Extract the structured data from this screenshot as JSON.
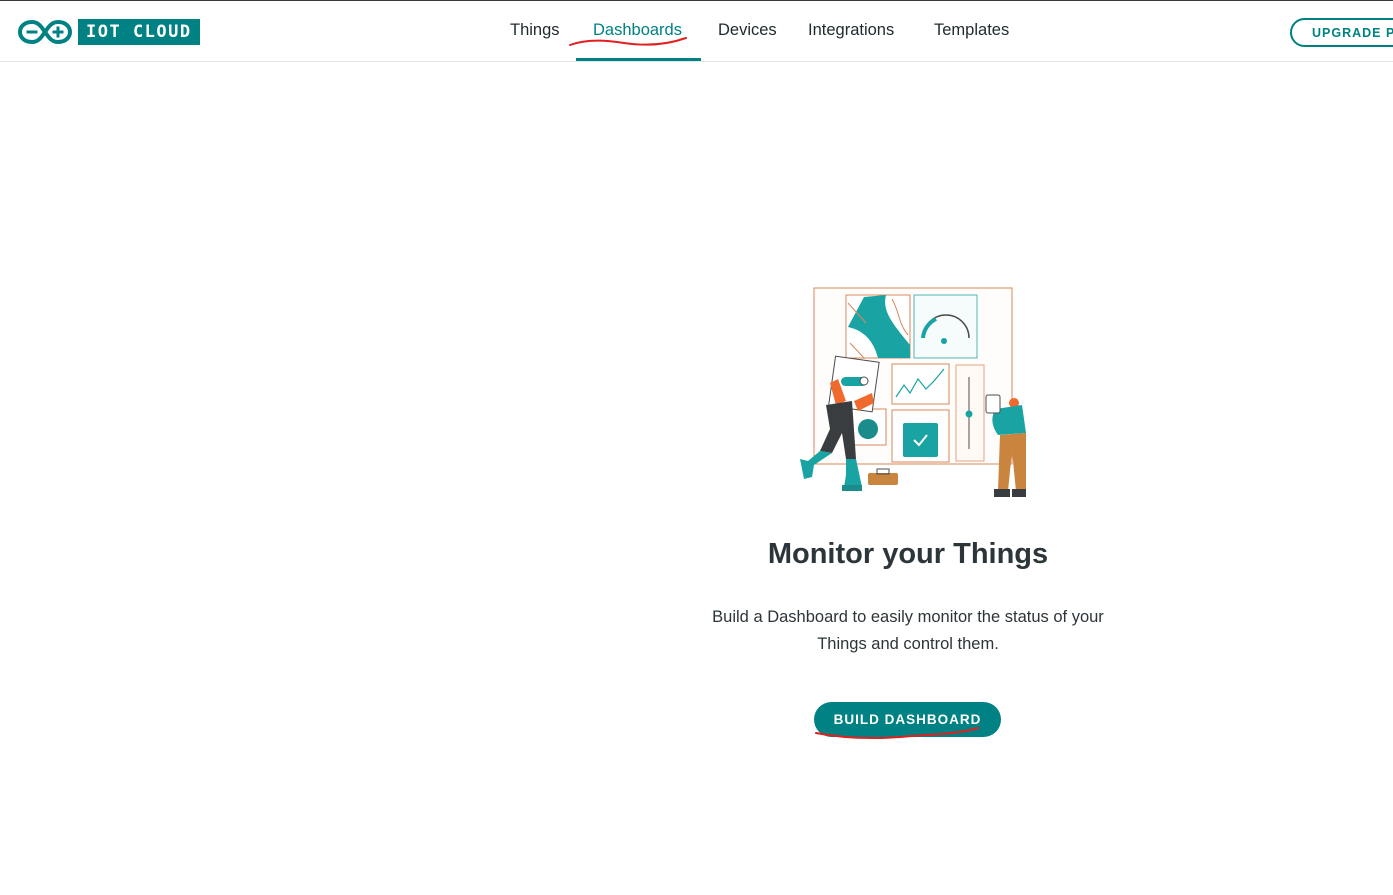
{
  "brand": {
    "logo_text": "IOT CLOUD",
    "icon": "infinity-plus-minus-icon",
    "accent_color": "#008184"
  },
  "nav": {
    "items": [
      {
        "label": "Things",
        "active": false
      },
      {
        "label": "Dashboards",
        "active": true
      },
      {
        "label": "Devices",
        "active": false
      },
      {
        "label": "Integrations",
        "active": false
      },
      {
        "label": "Templates",
        "active": false
      }
    ]
  },
  "header": {
    "upgrade_label": "UPGRADE PL"
  },
  "empty_state": {
    "illustration": "dashboard-builders-illustration",
    "title": "Monitor your Things",
    "description": "Build a Dashboard to easily monitor the status of your Things and control them.",
    "button_label": "BUILD DASHBOARD"
  },
  "annotation_color": "#e0201e"
}
